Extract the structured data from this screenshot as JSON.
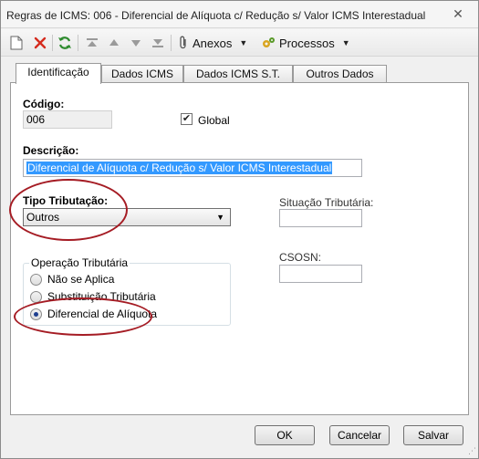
{
  "window": {
    "title": "Regras de ICMS: 006 - Diferencial de Alíquota c/ Redução s/ Valor ICMS Interestadual"
  },
  "toolbar": {
    "icons": [
      "new-document-icon",
      "delete-icon",
      "refresh-icon",
      "first-record-icon",
      "previous-record-icon",
      "next-record-icon",
      "last-record-icon",
      "paperclip-icon",
      "gear-icon"
    ],
    "anexos_label": "Anexos",
    "processos_label": "Processos"
  },
  "tabs": [
    {
      "label": "Identificação",
      "active": true
    },
    {
      "label": "Dados ICMS",
      "active": false
    },
    {
      "label": "Dados ICMS S.T.",
      "active": false
    },
    {
      "label": "Outros Dados",
      "active": false
    }
  ],
  "form": {
    "codigo_label": "Código:",
    "codigo_value": "006",
    "global_label": "Global",
    "global_checked": true,
    "descricao_label": "Descrição:",
    "descricao_value": "Diferencial de Alíquota c/ Redução s/ Valor ICMS Interestadual",
    "tipo_tributacao_label": "Tipo Tributação:",
    "tipo_tributacao_value": "Outros",
    "situacao_tributaria_label": "Situação Tributária:",
    "situacao_tributaria_value": "",
    "csosn_label": "CSOSN:",
    "csosn_value": "",
    "operacao_tributaria": {
      "legend": "Operação Tributária",
      "options": [
        {
          "label": "Não se Aplica",
          "selected": false
        },
        {
          "label": "Substituição Tributária",
          "selected": false
        },
        {
          "label": "Diferencial de Alíquota",
          "selected": true
        }
      ]
    }
  },
  "buttons": {
    "ok": "OK",
    "cancelar": "Cancelar",
    "salvar": "Salvar"
  },
  "colors": {
    "annotation": "#a51c24",
    "selection": "#3399ff",
    "delete": "#d52b1e",
    "refresh": "#2e8b2e"
  }
}
